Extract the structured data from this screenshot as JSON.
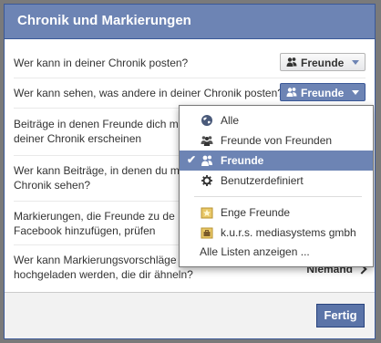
{
  "dialog": {
    "title": "Chronik und Markierungen",
    "done_label": "Fertig"
  },
  "rows": [
    {
      "text": "Wer kann in deiner Chronik posten?",
      "control": "Freunde"
    },
    {
      "text": "Wer kann sehen, was andere in deiner Chronik posten?",
      "control": "Freunde"
    },
    {
      "text_line1": "Beiträge in denen Freunde dich m",
      "text_line2": "deiner Chronik erscheinen"
    },
    {
      "text_line1": "Wer kann Beiträge, in denen du m",
      "text_line2": "Chronik sehen?"
    },
    {
      "text_line1": "Markierungen, die Freunde zu de",
      "text_line2": "Facebook hinzufügen, prüfen"
    },
    {
      "text_line1": "Wer kann Markierungsvorschläge sehen, wenn Fotos",
      "text_line2": "hochgeladen werden, die dir ähneln?",
      "control": "Niemand"
    }
  ],
  "audience_menu": {
    "items": [
      {
        "label": "Alle",
        "icon": "globe-icon"
      },
      {
        "label": "Freunde von Freunden",
        "icon": "friends-of-friends-icon"
      },
      {
        "label": "Freunde",
        "icon": "friends-icon",
        "selected": true
      },
      {
        "label": "Benutzerdefiniert",
        "icon": "gear-icon"
      }
    ],
    "lists": [
      {
        "label": "Enge Freunde",
        "icon": "star-list-icon"
      },
      {
        "label": "k.u.r.s. mediasystems gmbh",
        "icon": "briefcase-list-icon"
      }
    ],
    "all_lists_label": "Alle Listen anzeigen ..."
  },
  "colors": {
    "header_bg": "#6d84b4",
    "brand_dark": "#3b5998",
    "selected_bg": "#6d84b4"
  }
}
